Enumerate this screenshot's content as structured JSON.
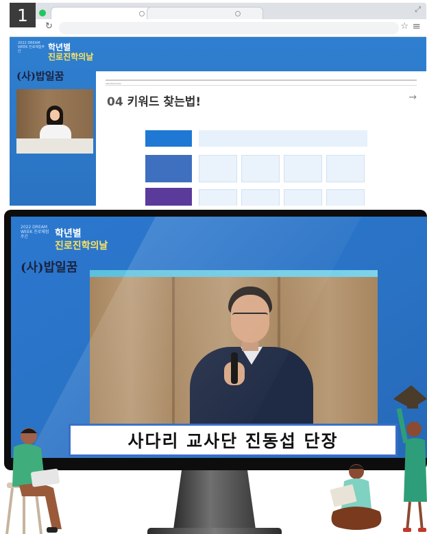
{
  "badge": {
    "number": "1"
  },
  "browser": {
    "brand": {
      "logo_text": "2022 DREAM WEEK 진로체험주간",
      "line1": "학년별",
      "line2": "진로진학의날",
      "org": "(사)밥일꿈"
    },
    "slide": {
      "tag": "PRESENTATION",
      "title_num": "04",
      "title_text": "키워드 찾는법!",
      "arrow": "→"
    },
    "icons": {
      "reload": "reload-icon",
      "star": "star-icon",
      "menu": "menu-icon",
      "expand": "expand-icon"
    }
  },
  "monitor": {
    "brand": {
      "logo_text": "2022 DREAM WEEK 진로체험주간",
      "line1": "학년별",
      "line2": "진로진학의날",
      "org": "(사)밥일꿈"
    },
    "caption": "사다리 교사단 진동섭 단장"
  },
  "colors": {
    "screen_blue": "#2b78cf",
    "brand_yellow": "#ffe45c",
    "caption_border": "#3a6fc8"
  }
}
